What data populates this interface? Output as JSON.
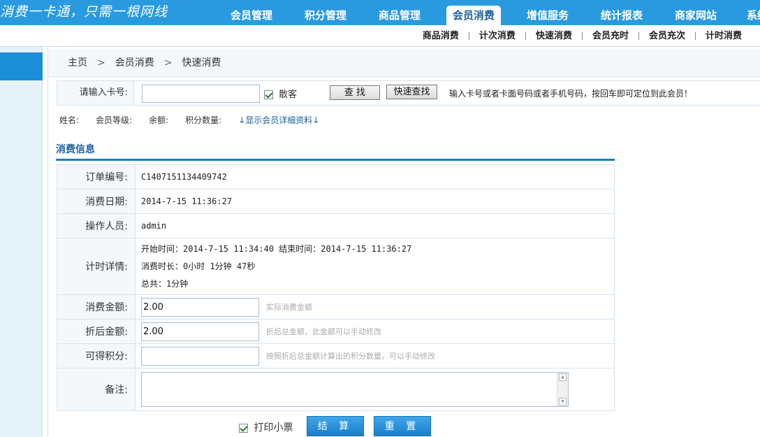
{
  "header": {
    "slogan": "消费一卡通，只需一根网线",
    "nav": [
      {
        "label": "会员管理",
        "active": false
      },
      {
        "label": "积分管理",
        "active": false
      },
      {
        "label": "商品管理",
        "active": false
      },
      {
        "label": "会员消费",
        "active": true
      },
      {
        "label": "增值服务",
        "active": false
      },
      {
        "label": "统计报表",
        "active": false
      },
      {
        "label": "商家网站",
        "active": false
      },
      {
        "label": "系统",
        "active": false
      }
    ],
    "subnav": [
      "商品消费",
      "计次消费",
      "快速消费",
      "会员充时",
      "会员充次",
      "计时消费"
    ]
  },
  "breadcrumb": [
    "主页",
    "会员消费",
    "快速消费"
  ],
  "search": {
    "label": "请输入卡号:",
    "value": "",
    "guest_label": "散客",
    "guest_checked": true,
    "find_button": "查 找",
    "quick_find_button": "快速查找",
    "hint": "输入卡号或者卡面号码或者手机号码，按回车即可定位到此会员！"
  },
  "member_info": {
    "name_label": "姓名:",
    "level_label": "会员等级:",
    "balance_label": "余额:",
    "points_label": "积分数量:",
    "detail_link": "↓显示会员详细资料↓"
  },
  "section_title": "消费信息",
  "form": {
    "order_no_label": "订单编号:",
    "order_no": "C1407151134409742",
    "date_label": "消费日期:",
    "date": "2014-7-15 11:36:27",
    "operator_label": "操作人员:",
    "operator": "admin",
    "timing_label": "计时详情:",
    "timing_line1": "开始时间：2014-7-15 11:34:40 结束时间：2014-7-15 11:36:27",
    "timing_line2": "消费时长：0小时 1分钟 47秒",
    "timing_line3": "总共：1分钟",
    "amount_label": "消费金额:",
    "amount": "2.00",
    "amount_hint": "实际消费金额",
    "discount_label": "折后金额:",
    "discount": "2.00",
    "discount_hint": "折后总金额，此金额可以手动修改",
    "points_label": "可得积分:",
    "points": "",
    "points_hint": "按照折后总金额计算出的积分数量，可以手动修改",
    "remark_label": "备注:",
    "remark": ""
  },
  "actions": {
    "print_label": "打印小票",
    "print_checked": true,
    "settle_button": "结 算",
    "reset_button": "重 置"
  }
}
